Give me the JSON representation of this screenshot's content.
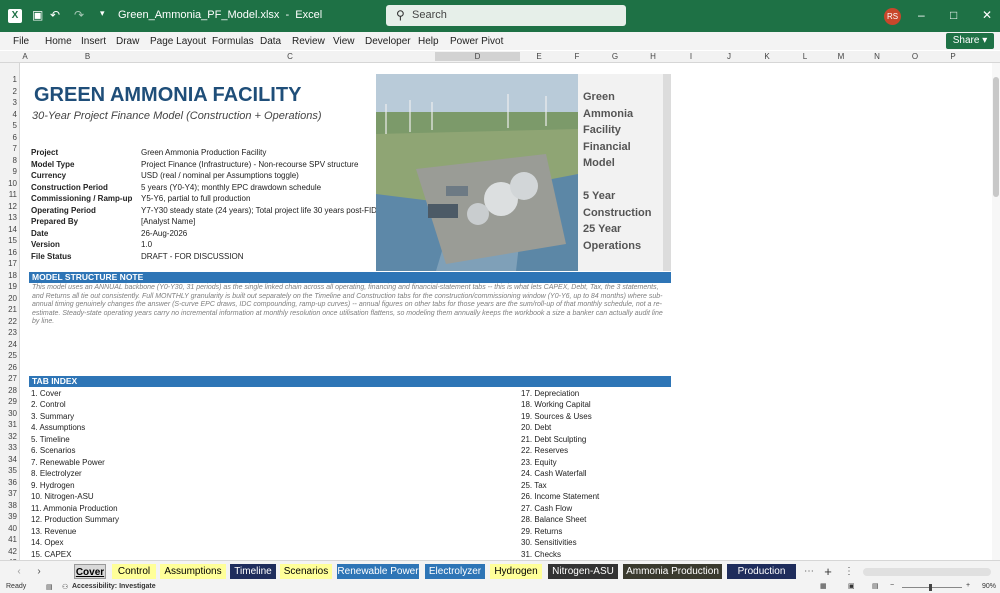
{
  "titlebar": {
    "app_icon": "X",
    "file_name": "Green_Ammonia_PF_Model.xlsx",
    "app": "Excel",
    "search_placeholder": "Search",
    "user_initials": "RS",
    "minimize": "–",
    "maximize": "□",
    "close": "✕"
  },
  "ribbon": {
    "tabs": [
      "File",
      "Home",
      "Insert",
      "Draw",
      "Page Layout",
      "Formulas",
      "Data",
      "Review",
      "View",
      "Developer",
      "Help",
      "Power Pivot"
    ],
    "share_label": "Share"
  },
  "columns": [
    "A",
    "B",
    "C",
    "D",
    "E",
    "F",
    "G",
    "H",
    "I",
    "J",
    "K",
    "L",
    "M",
    "N",
    "O",
    "P"
  ],
  "rows": [
    1,
    2,
    3,
    4,
    5,
    6,
    7,
    8,
    9,
    10,
    11,
    12,
    13,
    14,
    15,
    16,
    17,
    18,
    19,
    20,
    21,
    22,
    23,
    24,
    25,
    26,
    27,
    28,
    29,
    30,
    31,
    32,
    33,
    34,
    35,
    36,
    37,
    38,
    39,
    40,
    41,
    42,
    43
  ],
  "cover": {
    "title": "GREEN AMMONIA FACILITY",
    "subtitle": "30-Year Project Finance Model (Construction + Operations)",
    "card": [
      "Green",
      "Ammonia",
      "Facility",
      "Financial",
      "Model",
      "",
      "5 Year",
      "Construction",
      "25 Year",
      "Operations"
    ],
    "info": [
      {
        "label": "Project",
        "value": "Green Ammonia Production Facility"
      },
      {
        "label": "Model Type",
        "value": "Project Finance (Infrastructure) - Non-recourse SPV structure"
      },
      {
        "label": "Currency",
        "value": "USD (real / nominal per Assumptions toggle)"
      },
      {
        "label": "Construction Period",
        "value": "5 years (Y0-Y4); monthly EPC drawdown schedule"
      },
      {
        "label": "Commissioning / Ramp-up",
        "value": "Y5-Y6, partial to full production"
      },
      {
        "label": "Operating Period",
        "value": "Y7-Y30 steady state (24 years); Total project life 30 years post-FID"
      },
      {
        "label": "Prepared By",
        "value": "[Analyst Name]"
      },
      {
        "label": "Date",
        "value": "26-Aug-2026"
      },
      {
        "label": "Version",
        "value": "1.0"
      },
      {
        "label": "File Status",
        "value": "DRAFT - FOR DISCUSSION"
      }
    ],
    "structure_header": "MODEL STRUCTURE NOTE",
    "structure_note": "This model uses an ANNUAL backbone (Y0-Y30, 31 periods) as the single linked chain across all operating, financing and financial-statement tabs -- this is what lets CAPEX, Debt, Tax, the 3 statements, and Returns all tie out consistently. Full MONTHLY granularity is built out separately on the Timeline and Construction tabs for the construction/commissioning window (Y0-Y6, up to 84 months) where sub-annual timing genuinely changes the answer (S-curve EPC draws, IDC compounding, ramp-up curves) -- annual figures on other tabs for those years are the sum/roll-up of that monthly schedule, not a re-estimate. Steady-state operating years carry no incremental information at monthly resolution once utilisation flattens, so modeling them annually keeps the workbook a size a banker can actually audit line by line.",
    "index_header": "TAB INDEX",
    "index_left": [
      "1. Cover",
      "2. Control",
      "3. Summary",
      "4. Assumptions",
      "5. Timeline",
      "6. Scenarios",
      "7. Renewable Power",
      "8. Electrolyzer",
      "9. Hydrogen",
      "10. Nitrogen-ASU",
      "11. Ammonia Production",
      "12. Production Summary",
      "13. Revenue",
      "14. Opex",
      "15. CAPEX"
    ],
    "index_right": [
      "17. Depreciation",
      "18. Working Capital",
      "19. Sources & Uses",
      "20. Debt",
      "21. Debt Sculpting",
      "22. Reserves",
      "23. Equity",
      "24. Cash Waterfall",
      "25. Tax",
      "26. Income Statement",
      "27. Cash Flow",
      "28. Balance Sheet",
      "29. Returns",
      "30. Sensitivities",
      "31. Checks"
    ]
  },
  "sheet_tabs": [
    {
      "label": "Cover",
      "bg": "#d9d9d9",
      "fg": "#000000"
    },
    {
      "label": "Control",
      "bg": "#ffff99",
      "fg": "#000000"
    },
    {
      "label": "Assumptions",
      "bg": "#ffff99",
      "fg": "#000000"
    },
    {
      "label": "Timeline",
      "bg": "#1f2d5c",
      "fg": "#ffffff"
    },
    {
      "label": "Scenarios",
      "bg": "#ffff99",
      "fg": "#000000"
    },
    {
      "label": "Renewable Power",
      "bg": "#2e75b6",
      "fg": "#ffffff"
    },
    {
      "label": "Electrolyzer",
      "bg": "#2e75b6",
      "fg": "#ffffff"
    },
    {
      "label": "Hydrogen",
      "bg": "#ffff99",
      "fg": "#000000"
    },
    {
      "label": "Nitrogen-ASU",
      "bg": "#333333",
      "fg": "#ffffff"
    },
    {
      "label": "Ammonia Production",
      "bg": "#3a3a2e",
      "fg": "#ffffff"
    },
    {
      "label": "Production Sum",
      "bg": "#1f2d5c",
      "fg": "#ffffff"
    }
  ],
  "status": {
    "ready": "Ready",
    "accessibility": "Accessibility: Investigate",
    "zoom": "90%"
  }
}
